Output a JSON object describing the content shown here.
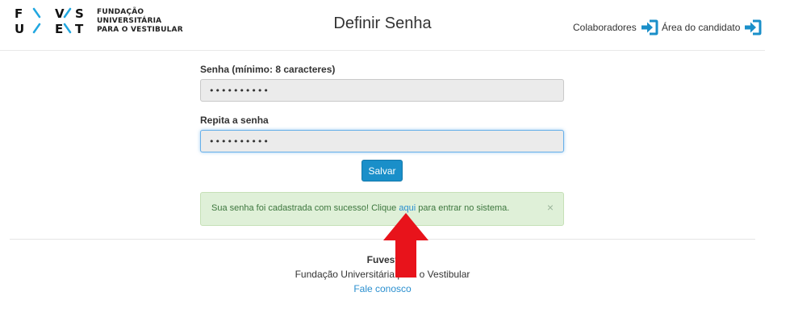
{
  "header": {
    "logo_text": [
      "FUNDAÇÃO",
      "UNIVERSITÁRIA",
      "PARA O VESTIBULAR"
    ],
    "logo_letters": [
      "F",
      "V",
      "S",
      "U",
      "E",
      "T"
    ],
    "title": "Definir Senha",
    "nav": [
      {
        "label": "Colaboradores",
        "icon": "login-icon"
      },
      {
        "label": "Área do candidato",
        "icon": "login-icon"
      }
    ]
  },
  "form": {
    "password_label": "Senha (mínimo: 8 caracteres)",
    "password_value": "••••••••••",
    "repeat_label": "Repita a senha",
    "repeat_value": "••••••••••",
    "save_label": "Salvar"
  },
  "alert": {
    "message_before": "Sua senha foi cadastrada com sucesso! Clique ",
    "link_text": "aqui",
    "message_after": " para entrar no sistema.",
    "close": "×"
  },
  "footer": {
    "org": "Fuvest",
    "full_name": "Fundação Universitária para o Vestibular",
    "contact": "Fale conosco"
  },
  "colors": {
    "accent": "#1a8fc9",
    "link": "#2a8fcf",
    "alert_bg": "#dff0d8",
    "alert_text": "#3c763d",
    "annotation_arrow": "#e8131b"
  }
}
